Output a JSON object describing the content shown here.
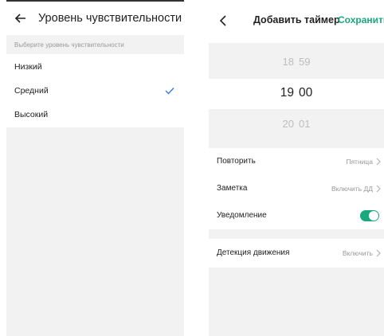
{
  "sensitivity": {
    "title": "Уровень чувствительности",
    "hint": "Выберите уровень чувствительности",
    "options": [
      "Низкий",
      "Средний",
      "Высокий"
    ],
    "selected": "Средний"
  },
  "timer": {
    "title": "Добавить таймер",
    "save_label": "Сохранить",
    "picker": {
      "above": {
        "hour": "18",
        "minute": "59"
      },
      "selected": {
        "hour": "19",
        "minute": "00"
      },
      "below": {
        "hour": "20",
        "minute": "01"
      }
    },
    "rows": {
      "repeat": {
        "label": "Повторить",
        "value": "Пятница"
      },
      "note": {
        "label": "Заметка",
        "value": "Включить ДД"
      },
      "notification": {
        "label": "Уведомление",
        "enabled": true
      },
      "motion": {
        "label": "Детекция движения",
        "value": "Включить"
      }
    }
  },
  "colors": {
    "accent": "#1aa87e",
    "check": "#3a7bd5",
    "background": "#f2f2f2"
  }
}
